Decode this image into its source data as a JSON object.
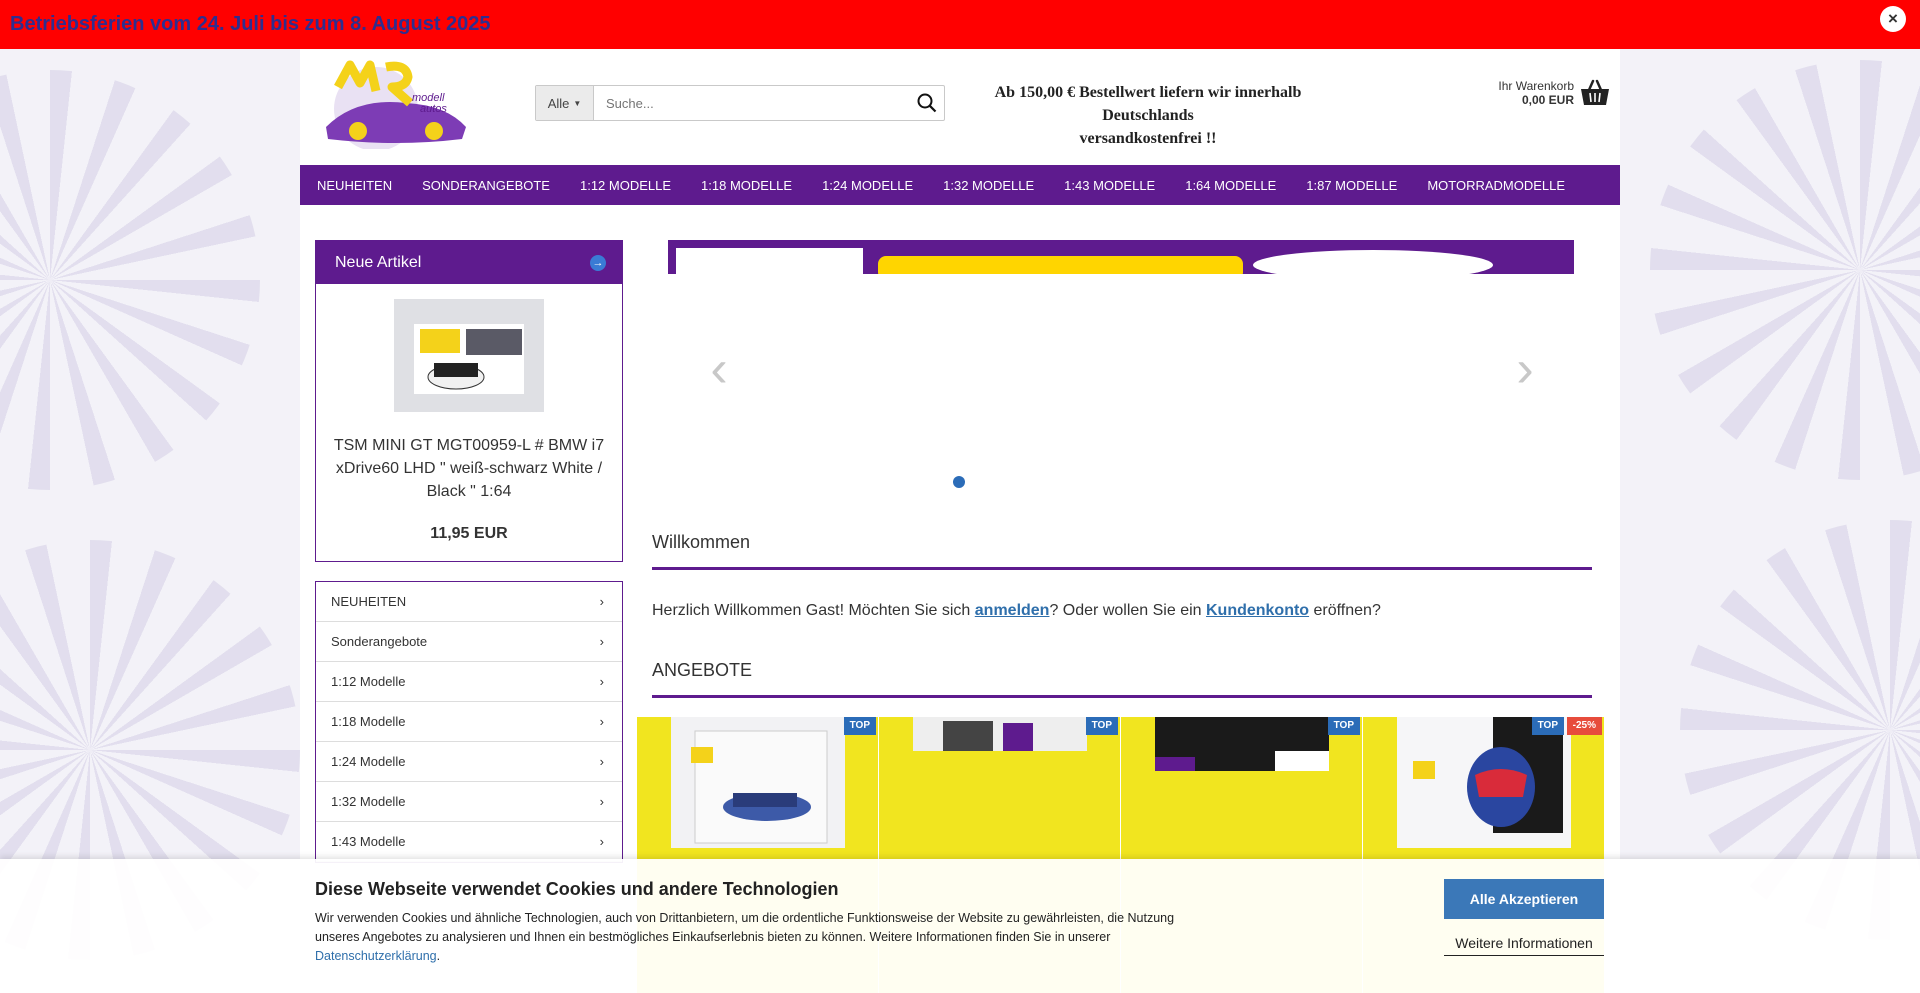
{
  "topbar": {
    "text": "Betriebsferien vom 24. Juli bis zum 8. August 2025",
    "close_label": "×"
  },
  "header": {
    "search": {
      "category": "Alle",
      "placeholder": "Suche..."
    },
    "shipping_note_line1": "Ab 150,00 € Bestellwert liefern wir innerhalb Deutschlands",
    "shipping_note_line2": "versandkostenfrei !!",
    "cart": {
      "label": "Ihr Warenkorb",
      "total": "0,00 EUR"
    }
  },
  "nav": [
    "NEUHEITEN",
    "SONDERANGEBOTE",
    "1:12 MODELLE",
    "1:18 MODELLE",
    "1:24 MODELLE",
    "1:32 MODELLE",
    "1:43 MODELLE",
    "1:64 MODELLE",
    "1:87 MODELLE",
    "MOTORRADMODELLE"
  ],
  "sidebar": {
    "new_articles": {
      "title": "Neue Artikel",
      "product_name": "TSM MINI GT MGT00959-L # BMW i7 xDrive60 LHD \" weiß-schwarz White / Black \" 1:64",
      "price": "11,95 EUR"
    },
    "categories": [
      "NEUHEITEN",
      "Sonderangebote",
      "1:12 Modelle",
      "1:18 Modelle",
      "1:24 Modelle",
      "1:32 Modelle",
      "1:43 Modelle"
    ]
  },
  "main": {
    "welcome_title": "Willkommen",
    "welcome_text_1": "Herzlich Willkommen Gast! Möchten Sie sich ",
    "login_link": "anmelden",
    "welcome_text_2": "? Oder wollen Sie ein ",
    "account_link": "Kundenkonto",
    "welcome_text_3": " eröffnen?",
    "offers_title": "ANGEBOTE",
    "products": [
      {
        "badges": [
          "TOP"
        ]
      },
      {
        "badges": [
          "TOP"
        ]
      },
      {
        "badges": [
          "TOP"
        ]
      },
      {
        "badges": [
          "TOP",
          "-25%"
        ]
      }
    ]
  },
  "cookie": {
    "title": "Diese Webseite verwendet Cookies und andere Technologien",
    "text": "Wir verwenden Cookies und ähnliche Technologien, auch von Drittanbietern, um die ordentliche Funktionsweise der Website zu gewährleisten, die Nutzung unseres Angebotes zu analysieren und Ihnen ein bestmögliches Einkaufserlebnis bieten zu können. Weitere Informationen finden Sie in unserer ",
    "privacy_link": "Datenschutzerklärung",
    "period": ".",
    "accept": "Alle Akzeptieren",
    "more": "Weitere Informationen"
  },
  "colors": {
    "brand_purple": "#5e1b8e",
    "banner_red": "#ff0000",
    "accent_blue": "#2b6cb8",
    "offer_yellow": "#f1e51f"
  }
}
